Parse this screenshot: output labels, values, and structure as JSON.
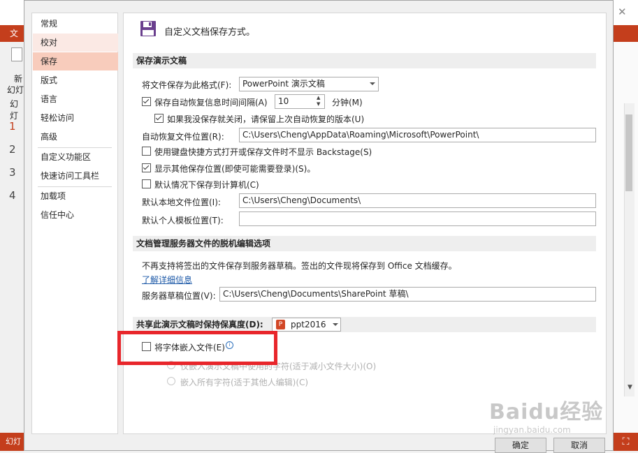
{
  "background": {
    "ribbon_tab": "文",
    "ribbon_new": "新",
    "ribbon_new2": "幻灯",
    "ribbon_slides": "幻灯",
    "slide_numbers": [
      "1",
      "2",
      "3",
      "4"
    ],
    "status_left": "幻灯"
  },
  "nav": {
    "items": [
      {
        "label": "常规"
      },
      {
        "label": "校对"
      },
      {
        "label": "保存"
      },
      {
        "label": "版式"
      },
      {
        "label": "语言"
      },
      {
        "label": "轻松访问"
      },
      {
        "label": "高级"
      },
      {
        "label": "自定义功能区"
      },
      {
        "label": "快速访问工具栏"
      },
      {
        "label": "加载项"
      },
      {
        "label": "信任中心"
      }
    ]
  },
  "header": {
    "title": "自定义文档保存方式。"
  },
  "save_section": {
    "title": "保存演示文稿",
    "format_label": "将文件保存为此格式(F):",
    "format_value": "PowerPoint 演示文稿",
    "autorecover_label": "保存自动恢复信息时间间隔(A)",
    "autorecover_checked": true,
    "interval_value": "10",
    "minutes_label": "分钟(M)",
    "keep_last_label": "如果我没保存就关闭，请保留上次自动恢复的版本(U)",
    "keep_last_checked": true,
    "autorecover_path_label": "自动恢复文件位置(R):",
    "autorecover_path": "C:\\Users\\Cheng\\AppData\\Roaming\\Microsoft\\PowerPoint\\",
    "no_backstage_label": "使用键盘快捷方式打开或保存文件时不显示 Backstage(S)",
    "no_backstage_checked": false,
    "show_other_label": "显示其他保存位置(即使可能需要登录)(S)。",
    "show_other_checked": true,
    "default_computer_label": "默认情况下保存到计算机(C)",
    "default_computer_checked": false,
    "local_path_label": "默认本地文件位置(I):",
    "local_path": "C:\\Users\\Cheng\\Documents\\",
    "template_label": "默认个人模板位置(T):",
    "template_path": ""
  },
  "server_section": {
    "title": "文档管理服务器文件的脱机编辑选项",
    "notice": "不再支持将签出的文件保存到服务器草稿。签出的文件现将保存到 Office 文档缓存。",
    "learn_more": "了解详细信息",
    "drafts_label": "服务器草稿位置(V):",
    "drafts_path": "C:\\Users\\Cheng\\Documents\\SharePoint 草稿\\"
  },
  "fidelity_section": {
    "title": "共享此演示文稿时保持保真度(D):",
    "file_value": "ppt2016",
    "embed_label": "将字体嵌入文件(E)",
    "embed_checked": false,
    "info_icon": "info-icon",
    "option1": "仅嵌入演示文稿中使用的字符(适于减小文件大小)(O)",
    "option2": "嵌入所有字符(适于其他人编辑)(C)"
  },
  "buttons": {
    "ok": "确定",
    "cancel": "取消"
  },
  "watermark": {
    "text": "Baidu经验",
    "url": "jingyan.baidu.com"
  },
  "colors": {
    "accent": "#c43e1c",
    "nav_selected": "#f8ccbc",
    "highlight": "#e8262b",
    "link": "#1e5aa8"
  }
}
